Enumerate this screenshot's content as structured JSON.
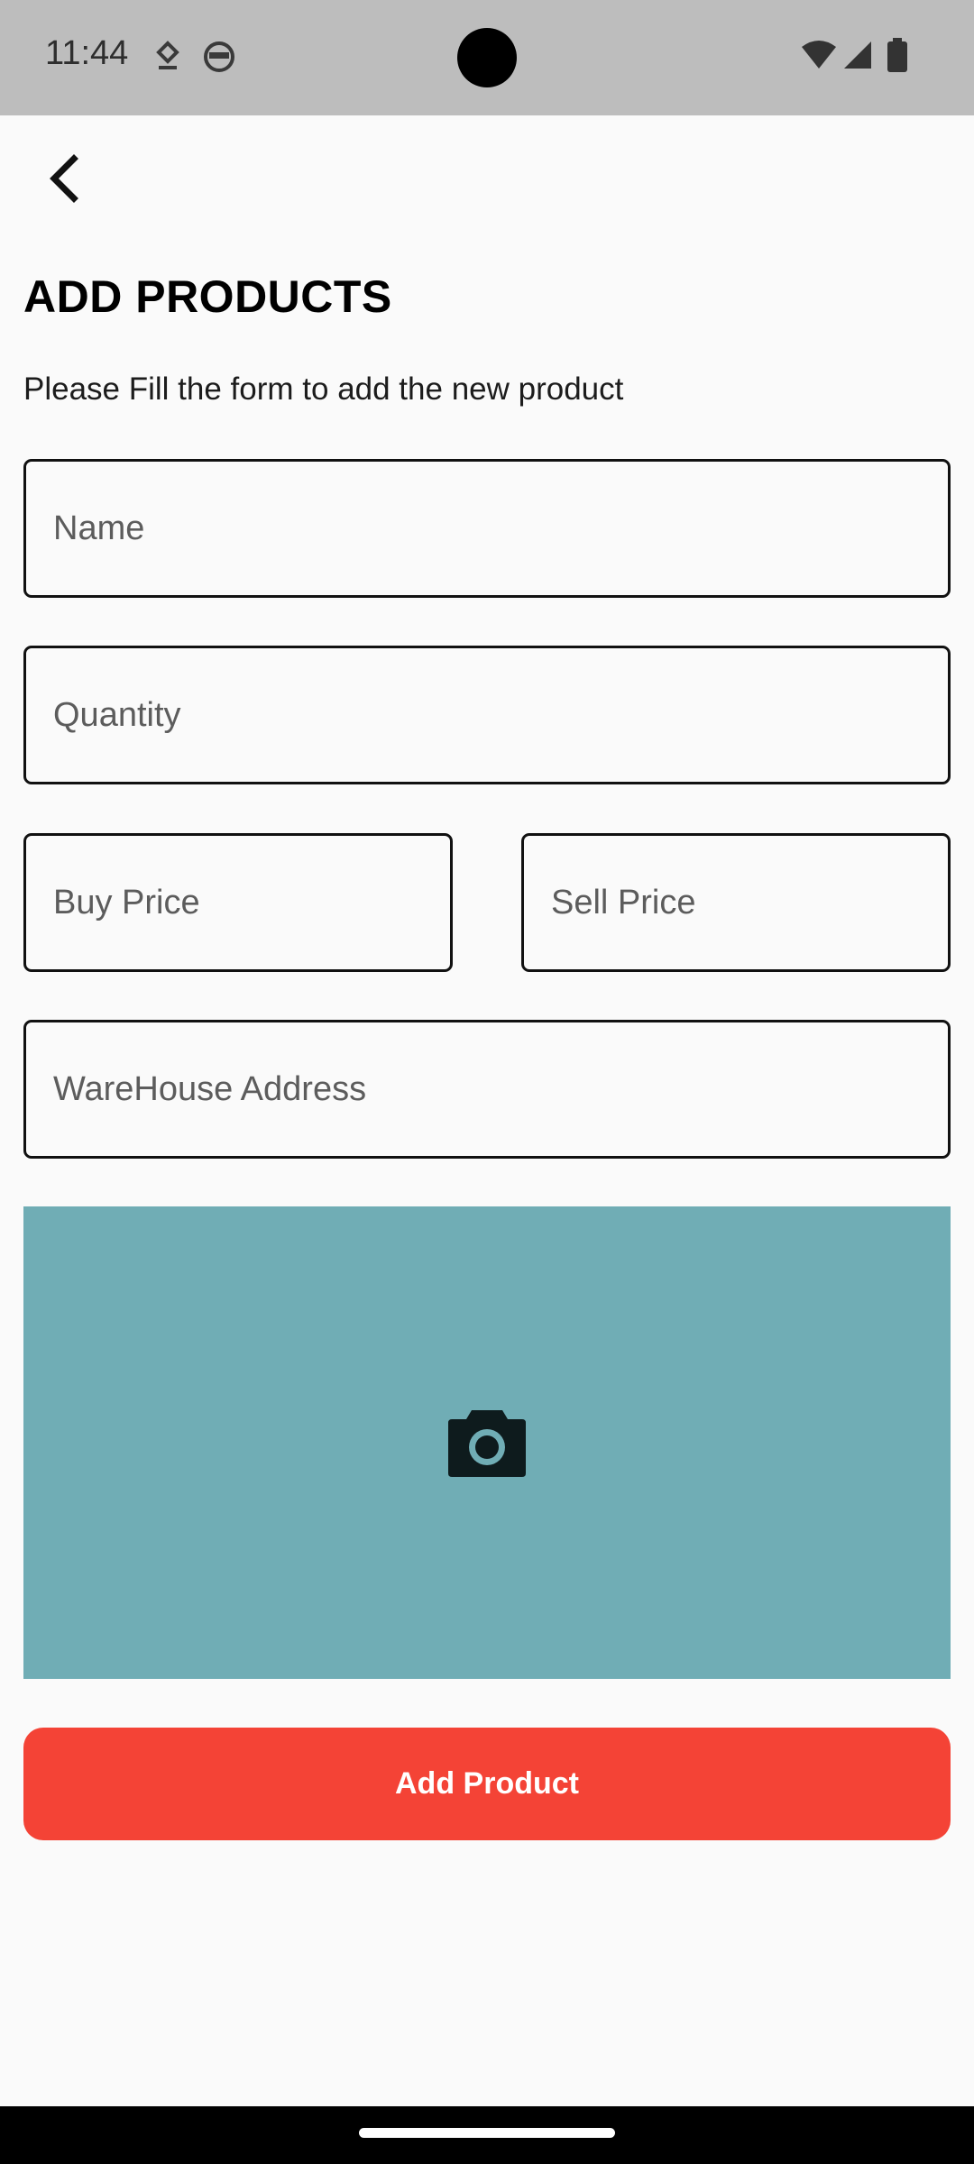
{
  "status_bar": {
    "time": "11:44",
    "left_icons": [
      "notification-download-icon",
      "android-face-icon"
    ],
    "right_icons": [
      "wifi-icon",
      "cell-signal-icon",
      "battery-icon"
    ]
  },
  "app_bar": {
    "back_icon": "chevron-left-icon"
  },
  "page": {
    "title": "ADD PRODUCTS",
    "subtitle": "Please Fill the form to add the new product"
  },
  "form": {
    "name": {
      "placeholder": "Name",
      "value": ""
    },
    "quantity": {
      "placeholder": "Quantity",
      "value": ""
    },
    "buy_price": {
      "placeholder": "Buy Price",
      "value": ""
    },
    "sell_price": {
      "placeholder": "Sell Price",
      "value": ""
    },
    "warehouse_address": {
      "placeholder": "WareHouse Address",
      "value": ""
    }
  },
  "image_picker": {
    "icon": "camera-icon",
    "background_color": "#70ADB5"
  },
  "submit": {
    "label": "Add Product",
    "color": "#F44336"
  }
}
